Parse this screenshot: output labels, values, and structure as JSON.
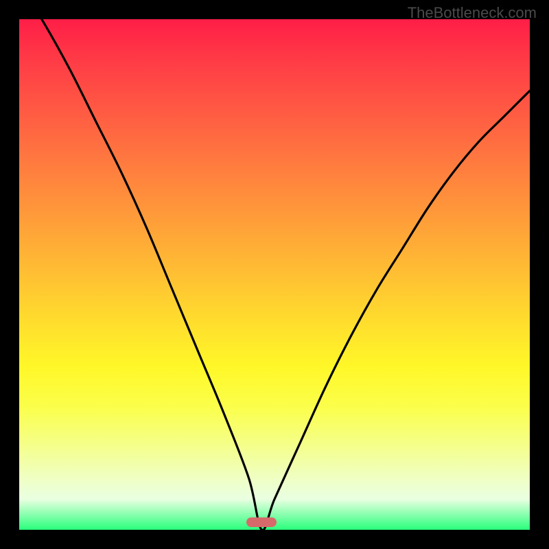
{
  "watermark": "TheBottleneck.com",
  "colors": {
    "background": "#000000",
    "gradient_top": "#ff1e47",
    "gradient_bottom": "#29ff7b",
    "curve_stroke": "#000000",
    "marker_fill": "#d66a6a",
    "watermark_text": "#4a4a4a"
  },
  "marker": {
    "x_fraction": 0.475,
    "y_fraction": 0.985
  },
  "chart_data": {
    "type": "line",
    "title": "",
    "xlabel": "",
    "ylabel": "",
    "x": [
      0.0,
      0.05,
      0.1,
      0.15,
      0.2,
      0.25,
      0.3,
      0.35,
      0.4,
      0.45,
      0.475,
      0.5,
      0.55,
      0.6,
      0.65,
      0.7,
      0.75,
      0.8,
      0.85,
      0.9,
      0.95,
      1.0
    ],
    "values": [
      1.07,
      0.99,
      0.9,
      0.8,
      0.7,
      0.59,
      0.47,
      0.35,
      0.23,
      0.1,
      0.0,
      0.06,
      0.17,
      0.28,
      0.38,
      0.47,
      0.55,
      0.63,
      0.7,
      0.76,
      0.81,
      0.86
    ],
    "xlim": [
      0,
      1
    ],
    "ylim": [
      0,
      1
    ],
    "series": [
      {
        "name": "bottleneck-curve",
        "x": [
          0.0,
          0.05,
          0.1,
          0.15,
          0.2,
          0.25,
          0.3,
          0.35,
          0.4,
          0.45,
          0.475,
          0.5,
          0.55,
          0.6,
          0.65,
          0.7,
          0.75,
          0.8,
          0.85,
          0.9,
          0.95,
          1.0
        ],
        "y": [
          1.07,
          0.99,
          0.9,
          0.8,
          0.7,
          0.59,
          0.47,
          0.35,
          0.23,
          0.1,
          0.0,
          0.06,
          0.17,
          0.28,
          0.38,
          0.47,
          0.55,
          0.63,
          0.7,
          0.76,
          0.81,
          0.86
        ]
      }
    ],
    "annotations": [
      {
        "type": "marker-pill",
        "x": 0.475,
        "y": 0.0,
        "color": "#d66a6a"
      }
    ]
  }
}
